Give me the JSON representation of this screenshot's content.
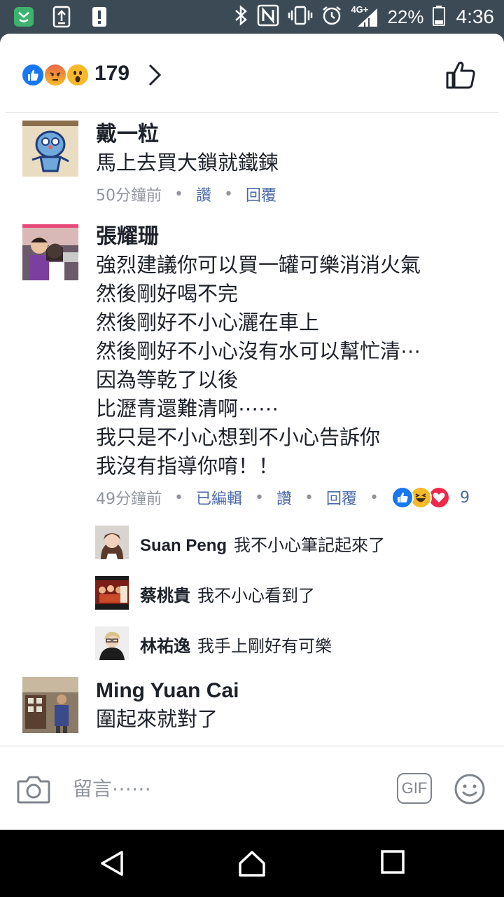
{
  "status_bar": {
    "battery_percent": "22%",
    "time": "4:36",
    "network": "4G+",
    "icons": [
      "app-badge-icon",
      "upload-icon",
      "alert-icon",
      "bluetooth-icon",
      "nfc-icon",
      "vibrate-icon",
      "alarm-icon",
      "signal-icon",
      "battery-icon"
    ]
  },
  "header": {
    "reaction_icons": [
      "like-reaction-icon",
      "angry-reaction-icon",
      "wow-reaction-icon"
    ],
    "reaction_count": "179"
  },
  "comments": [
    {
      "name": "戴一粒",
      "text": "馬上去買大鎖就鐵鍊",
      "time": "50分鐘前",
      "like_label": "讚",
      "reply_label": "回覆"
    },
    {
      "name": "張耀珊",
      "text": "強烈建議你可以買一罐可樂消消火氣\n然後剛好喝不完\n然後剛好不小心灑在車上\n然後剛好不小心沒有水可以幫忙清⋯\n因為等乾了以後\n比瀝青還難清啊⋯⋯\n我只是不小心想到不小心告訴你\n我沒有指導你唷！！",
      "time": "49分鐘前",
      "edited_label": "已編輯",
      "like_label": "讚",
      "reply_label": "回覆",
      "reaction_icons": [
        "like-reaction-icon",
        "haha-reaction-icon",
        "love-reaction-icon"
      ],
      "reaction_count": "9",
      "replies": [
        {
          "name": "Suan Peng",
          "text": "我不小心筆記起來了"
        },
        {
          "name": "蔡桃貴",
          "text": "我不小心看到了"
        },
        {
          "name": "林祐逸",
          "text": "我手上剛好有可樂"
        }
      ]
    },
    {
      "name": "Ming Yuan Cai",
      "text": "圍起來就對了"
    }
  ],
  "composer": {
    "placeholder": "留言⋯⋯",
    "gif_label": "GIF"
  },
  "colors": {
    "status_bar_bg": "#3c4a56",
    "link": "#4b6aa6",
    "meta_text": "#90949c",
    "like_blue": "#1877f2",
    "angry_orange": "#e8694a",
    "wow_yellow": "#f7b928",
    "love_red": "#f0284a"
  }
}
